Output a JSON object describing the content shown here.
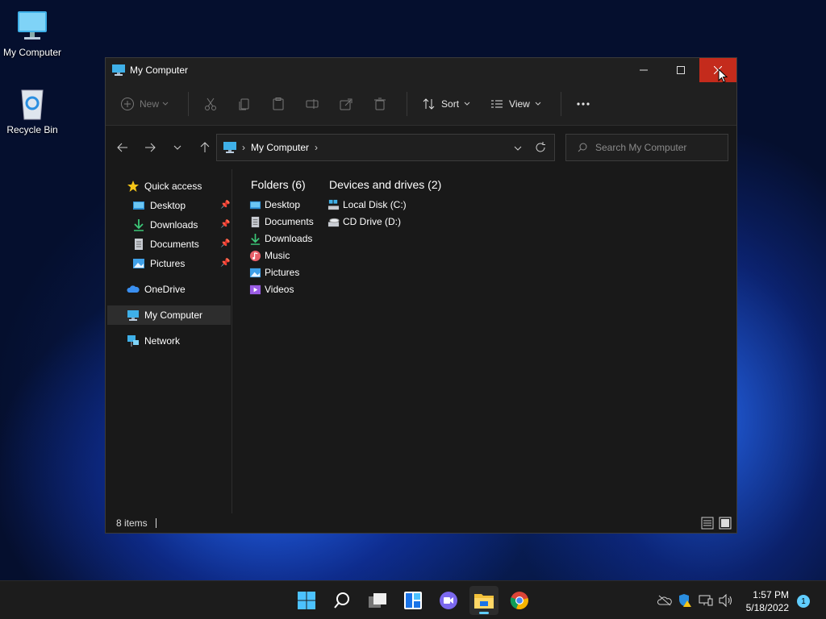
{
  "desktop": {
    "icons": [
      {
        "label": "My Computer"
      },
      {
        "label": "Recycle Bin"
      }
    ]
  },
  "window": {
    "title": "My Computer",
    "controls": {
      "minimize": "minimize",
      "maximize": "maximize",
      "close": "close"
    }
  },
  "toolbar": {
    "new_label": "New",
    "sort_label": "Sort",
    "view_label": "View"
  },
  "navbar": {
    "address_label": "My Computer",
    "search_placeholder": "Search My Computer"
  },
  "sidebar": {
    "items": [
      {
        "label": "Quick access",
        "icon": "star-icon"
      },
      {
        "label": "Desktop",
        "icon": "desktop-folder-icon",
        "pinned": true
      },
      {
        "label": "Downloads",
        "icon": "downloads-icon",
        "pinned": true
      },
      {
        "label": "Documents",
        "icon": "documents-icon",
        "pinned": true
      },
      {
        "label": "Pictures",
        "icon": "pictures-icon",
        "pinned": true
      },
      {
        "label": "OneDrive",
        "icon": "cloud-icon"
      },
      {
        "label": "My Computer",
        "icon": "computer-icon",
        "selected": true
      },
      {
        "label": "Network",
        "icon": "network-icon"
      }
    ]
  },
  "content": {
    "folders_heading": "Folders (6)",
    "folders": [
      {
        "label": "Desktop",
        "icon": "desktop-folder-icon"
      },
      {
        "label": "Documents",
        "icon": "documents-icon"
      },
      {
        "label": "Downloads",
        "icon": "downloads-icon"
      },
      {
        "label": "Music",
        "icon": "music-icon"
      },
      {
        "label": "Pictures",
        "icon": "pictures-icon"
      },
      {
        "label": "Videos",
        "icon": "videos-icon"
      }
    ],
    "drives_heading": "Devices and drives (2)",
    "drives": [
      {
        "label": "Local Disk (C:)",
        "icon": "local-disk-icon"
      },
      {
        "label": "CD Drive (D:)",
        "icon": "cd-drive-icon"
      }
    ]
  },
  "status": {
    "items_count": "8 items"
  },
  "taskbar": {
    "time": "1:57 PM",
    "date": "5/18/2022",
    "notification_count": "1"
  },
  "colors": {
    "close_red": "#c42b1c",
    "accent": "#60cdff",
    "window_bg": "#191919"
  }
}
